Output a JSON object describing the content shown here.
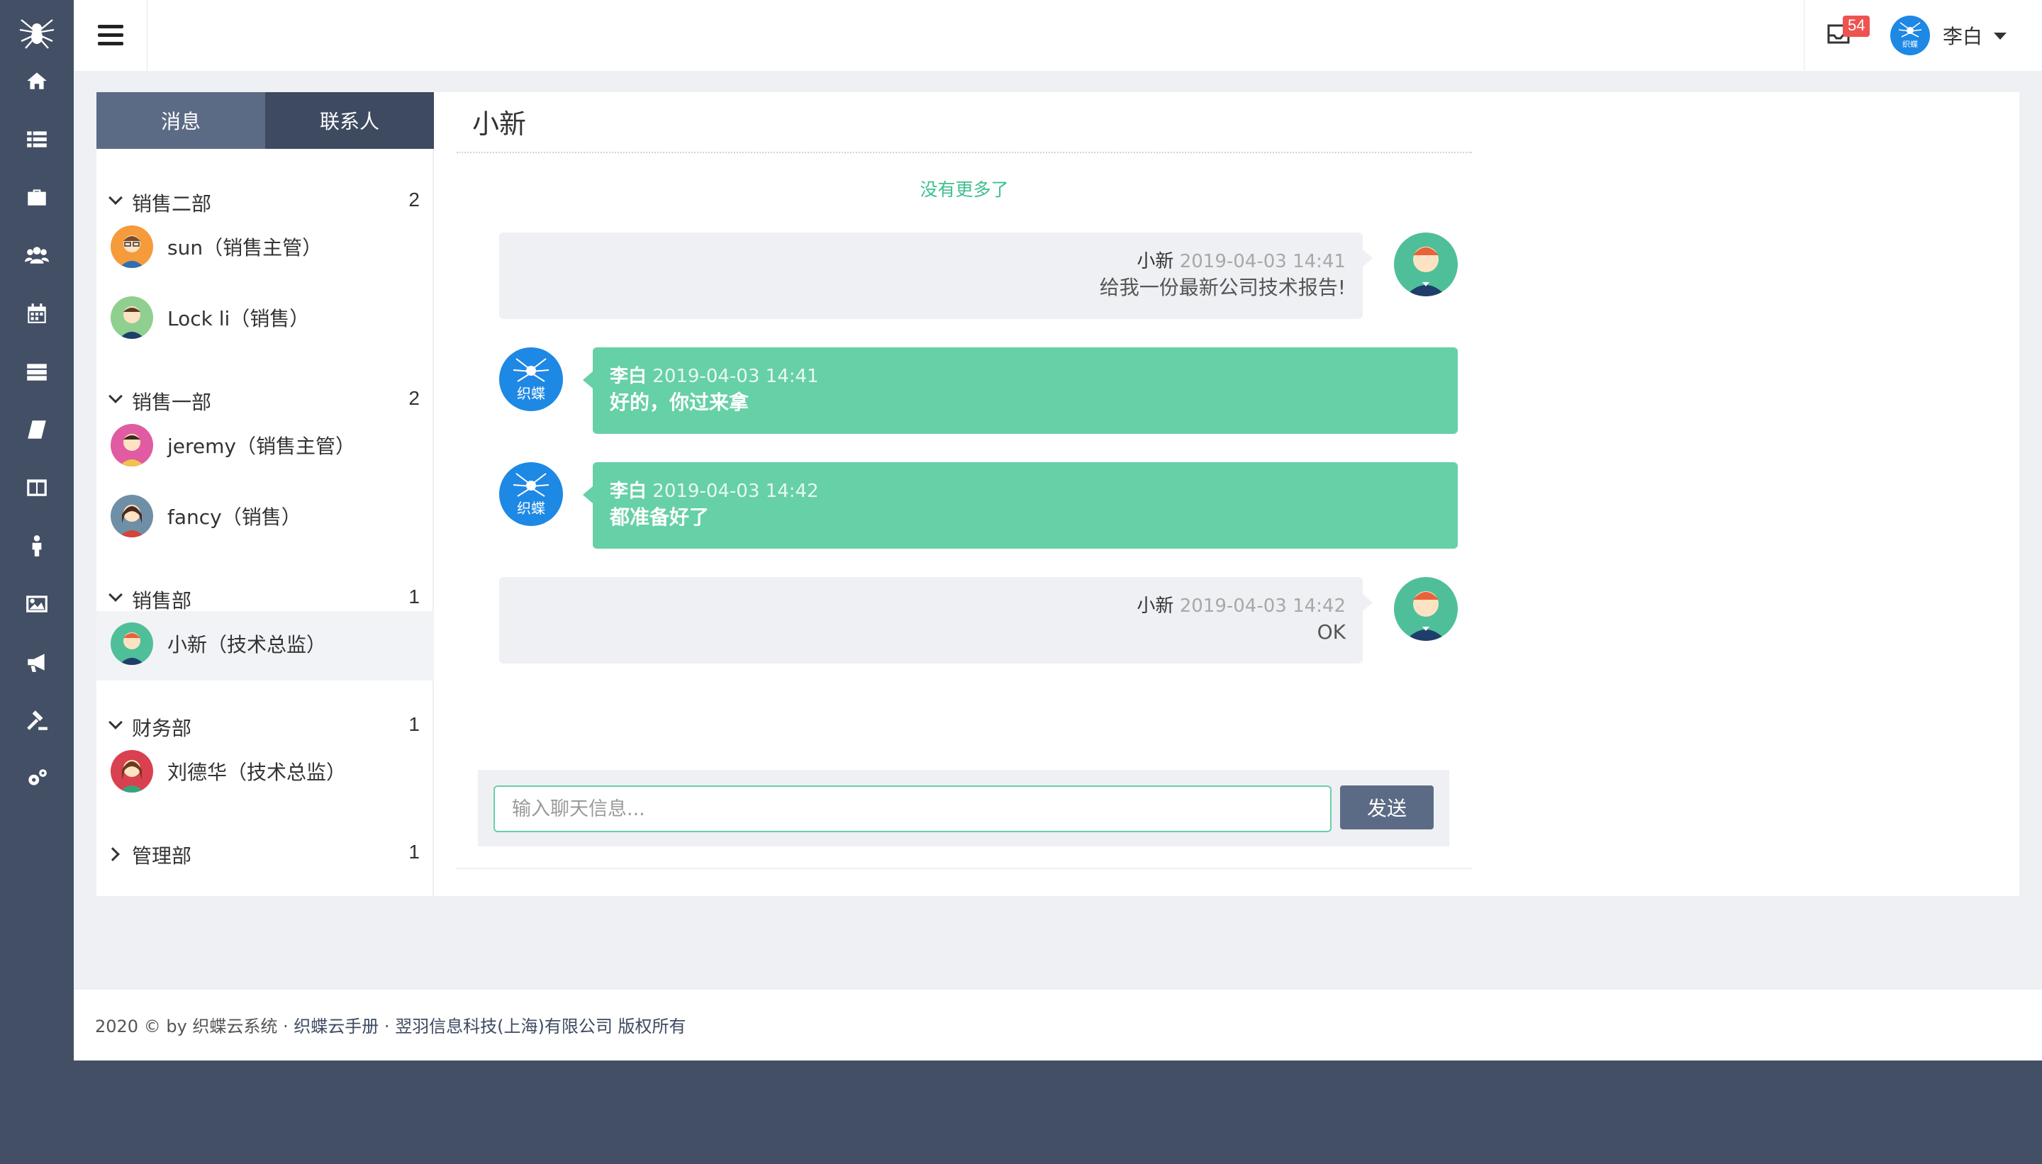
{
  "app": {
    "brand_color": "#434f65",
    "accent": "#66d0a6"
  },
  "sidebar": {
    "icons": [
      "home-icon",
      "list-icon",
      "briefcase-icon",
      "users-icon",
      "calendar-icon",
      "server-icon",
      "book-icon",
      "columns-icon",
      "person-icon",
      "image-icon",
      "bullhorn-icon",
      "gavel-icon",
      "gears-icon"
    ]
  },
  "topbar": {
    "mail_badge": "54",
    "user_name": "李白"
  },
  "tabs": {
    "messages": "消息",
    "contacts": "联系人"
  },
  "groups": [
    {
      "name": "销售二部",
      "count": "2",
      "members": [
        "sun（销售主管）",
        "Lock li（销售）"
      ]
    },
    {
      "name": "销售一部",
      "count": "2",
      "members": [
        "jeremy（销售主管）",
        "fancy（销售）"
      ]
    },
    {
      "name": "销售部",
      "count": "1",
      "members": [
        "小新（技术总监）"
      ]
    },
    {
      "name": "财务部",
      "count": "1",
      "members": [
        "刘德华（技术总监）"
      ]
    },
    {
      "name": "管理部",
      "count": "1",
      "members": []
    }
  ],
  "chat": {
    "title": "小新",
    "no_more": "没有更多了",
    "messages": [
      {
        "sender": "小新",
        "time": "2019-04-03 14:41",
        "text": "给我一份最新公司技术报告!",
        "side": "other"
      },
      {
        "sender": "李白",
        "time": "2019-04-03 14:41",
        "text": "好的，你过来拿",
        "side": "mine"
      },
      {
        "sender": "李白",
        "time": "2019-04-03 14:42",
        "text": "都准备好了",
        "side": "mine"
      },
      {
        "sender": "小新",
        "time": "2019-04-03 14:42",
        "text": "OK",
        "side": "other"
      }
    ],
    "input_placeholder": "输入聊天信息...",
    "send_label": "发送"
  },
  "footer": {
    "prefix": "2020 © by 织蝶云系统 · ",
    "link_manual": "织蝶云手册",
    "sep": " · ",
    "link_company": "翌羽信息科技(上海)有限公司 版权所有"
  }
}
